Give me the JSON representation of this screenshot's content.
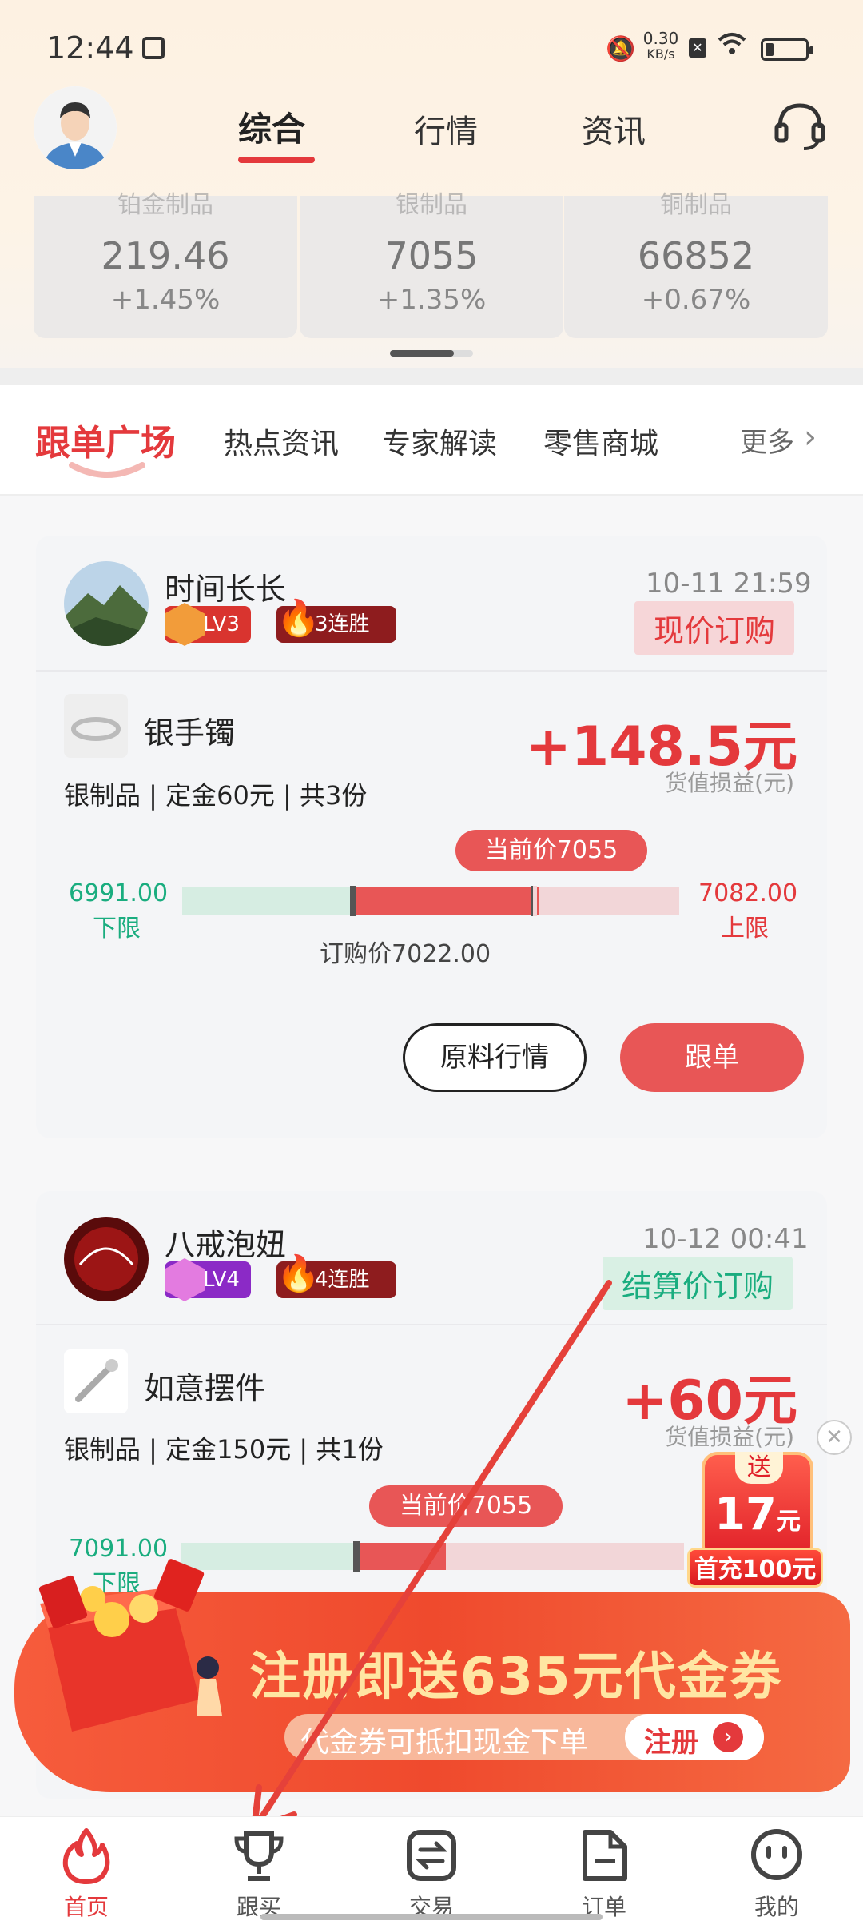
{
  "status_bar": {
    "time": "12:44",
    "net_speed_top": "0.30",
    "net_speed_unit": "KB/s",
    "battery_label": "battery"
  },
  "header": {
    "tabs": [
      {
        "label": "综合",
        "active": true
      },
      {
        "label": "行情"
      },
      {
        "label": "资讯"
      }
    ]
  },
  "metals": [
    {
      "name": "铂金制品",
      "price": "219.46",
      "change": "+1.45%"
    },
    {
      "name": "银制品",
      "price": "7055",
      "change": "+1.35%"
    },
    {
      "name": "铜制品",
      "price": "66852",
      "change": "+0.67%"
    }
  ],
  "sections": {
    "items": [
      {
        "label": "跟单广场",
        "active": true
      },
      {
        "label": "热点资讯"
      },
      {
        "label": "专家解读"
      },
      {
        "label": "零售商城"
      }
    ],
    "more": "更多"
  },
  "orders": [
    {
      "user": "时间长长",
      "level": "LV3",
      "streak": "3连胜",
      "time": "10-11 21:59",
      "type": "现价订购",
      "product": "银手镯",
      "meta": "银制品 | 定金60元 | 共3份",
      "gain": "+148.5元",
      "gain_label": "货值损益(元)",
      "current_price": "当前价7055",
      "lower": "6991.00",
      "lower_label": "下限",
      "upper": "7082.00",
      "upper_label": "上限",
      "order_price": "订购价7022.00",
      "btn_market": "原料行情",
      "btn_follow": "跟单"
    },
    {
      "user": "八戒泡妞",
      "level": "LV4",
      "streak": "4连胜",
      "time": "10-12 00:41",
      "type": "结算价订购",
      "product": "如意摆件",
      "meta": "银制品 | 定金150元 | 共1份",
      "gain": "+60元",
      "gain_label": "货值损益(元)",
      "current_price": "当前价7055",
      "lower": "7091.00",
      "lower_label": "下限"
    }
  ],
  "promo_float": {
    "top": "送",
    "amount": "17",
    "unit": "元",
    "bottom": "首充100元"
  },
  "banner": {
    "title": "注册即送635元代金券",
    "subtitle": "代金券可抵扣现金下单",
    "cta": "注册"
  },
  "bottom_nav": [
    {
      "label": "首页",
      "icon": "flame-icon",
      "active": true
    },
    {
      "label": "跟买",
      "icon": "trophy-icon"
    },
    {
      "label": "交易",
      "icon": "exchange-icon"
    },
    {
      "label": "订单",
      "icon": "document-icon"
    },
    {
      "label": "我的",
      "icon": "face-icon"
    }
  ],
  "colors": {
    "accent": "#e4393c",
    "green": "#1aad7f",
    "bar_green": "#d6ede2",
    "bar_red": "#e85656",
    "bar_pink": "#f2d6d8"
  }
}
